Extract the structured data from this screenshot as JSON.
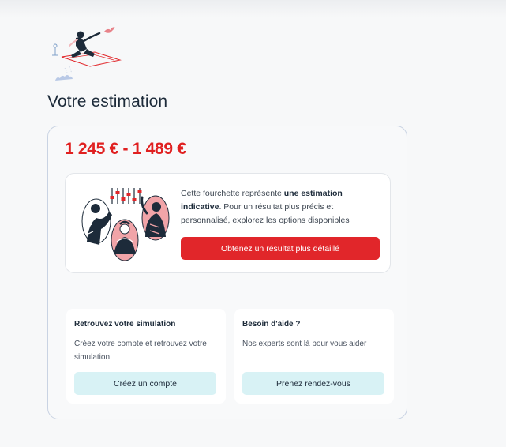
{
  "page": {
    "title": "Votre estimation"
  },
  "estimate": {
    "price_range": "1 245 € - 1 489 €",
    "description": {
      "part1": "Cette fourchette représente ",
      "bold": "une estimation indicative",
      "part2": ". Pour un résultat plus précis et personnalisé, explorez les options disponibles"
    },
    "primary_button": "Obtenez un résultat plus détaillé"
  },
  "actions": [
    {
      "title": "Retrouvez votre simulation",
      "description": "Créez votre compte et retrouvez votre simulation",
      "button": "Créez un compte"
    },
    {
      "title": "Besoin d'aide ?",
      "description": "Nos experts sont là pour vous aider",
      "button": "Prenez rendez-vous"
    }
  ],
  "colors": {
    "accent_red": "#e1262a",
    "price_red": "#e02020",
    "secondary_button": "#d8f2f5",
    "card_border": "#c9d3e3"
  },
  "icons": [
    "flying-person-illustration",
    "team-mixing-console-illustration"
  ]
}
